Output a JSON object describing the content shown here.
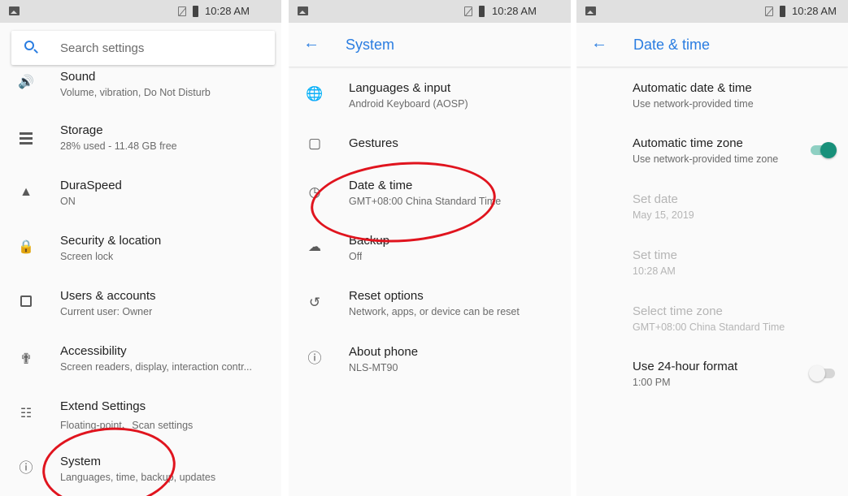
{
  "status_bar": {
    "time": "10:28 AM"
  },
  "panel_settings": {
    "search_placeholder": "Search settings",
    "items": [
      {
        "title": "Sound",
        "subtitle": "Volume, vibration, Do Not Disturb",
        "icon": "volume-icon"
      },
      {
        "title": "Storage",
        "subtitle": "28% used - 11.48 GB free",
        "icon": "storage-icon"
      },
      {
        "title": "DuraSpeed",
        "subtitle": "ON",
        "icon": "rocket-icon"
      },
      {
        "title": "Security & location",
        "subtitle": "Screen lock",
        "icon": "lock-icon"
      },
      {
        "title": "Users & accounts",
        "subtitle": "Current user: Owner",
        "icon": "account-icon"
      },
      {
        "title": "Accessibility",
        "subtitle": "Screen readers, display, interaction contr...",
        "icon": "accessibility-icon"
      },
      {
        "title": "Extend Settings",
        "subtitle": "Floating-point、Scan settings",
        "icon": "sliders-icon"
      },
      {
        "title": "System",
        "subtitle": "Languages, time, backup, updates",
        "icon": "info-icon"
      }
    ]
  },
  "panel_system": {
    "title": "System",
    "items": [
      {
        "title": "Languages & input",
        "subtitle": "Android Keyboard (AOSP)",
        "icon": "globe-icon"
      },
      {
        "title": "Gestures",
        "subtitle": "",
        "icon": "gesture-icon"
      },
      {
        "title": "Date & time",
        "subtitle": "GMT+08:00 China Standard Time",
        "icon": "clock-icon"
      },
      {
        "title": "Backup",
        "subtitle": "Off",
        "icon": "cloud-upload-icon"
      },
      {
        "title": "Reset options",
        "subtitle": "Network, apps, or device can be reset",
        "icon": "history-icon"
      },
      {
        "title": "About phone",
        "subtitle": "NLS-MT90",
        "icon": "info-icon"
      }
    ]
  },
  "panel_datetime": {
    "title": "Date & time",
    "items": [
      {
        "title": "Automatic date & time",
        "subtitle": "Use network-provided time",
        "enabled": true
      },
      {
        "title": "Automatic time zone",
        "subtitle": "Use network-provided time zone",
        "enabled": true,
        "toggle": "on"
      },
      {
        "title": "Set date",
        "subtitle": "May 15, 2019",
        "enabled": false
      },
      {
        "title": "Set time",
        "subtitle": "10:28 AM",
        "enabled": false
      },
      {
        "title": "Select time zone",
        "subtitle": "GMT+08:00 China Standard Time",
        "enabled": false
      },
      {
        "title": "Use 24-hour format",
        "subtitle": "1:00 PM",
        "enabled": true,
        "toggle": "off"
      }
    ]
  },
  "colors": {
    "accent": "#2a7de1",
    "toggle_on": "#18907a",
    "highlight_circle": "#e0141e"
  }
}
